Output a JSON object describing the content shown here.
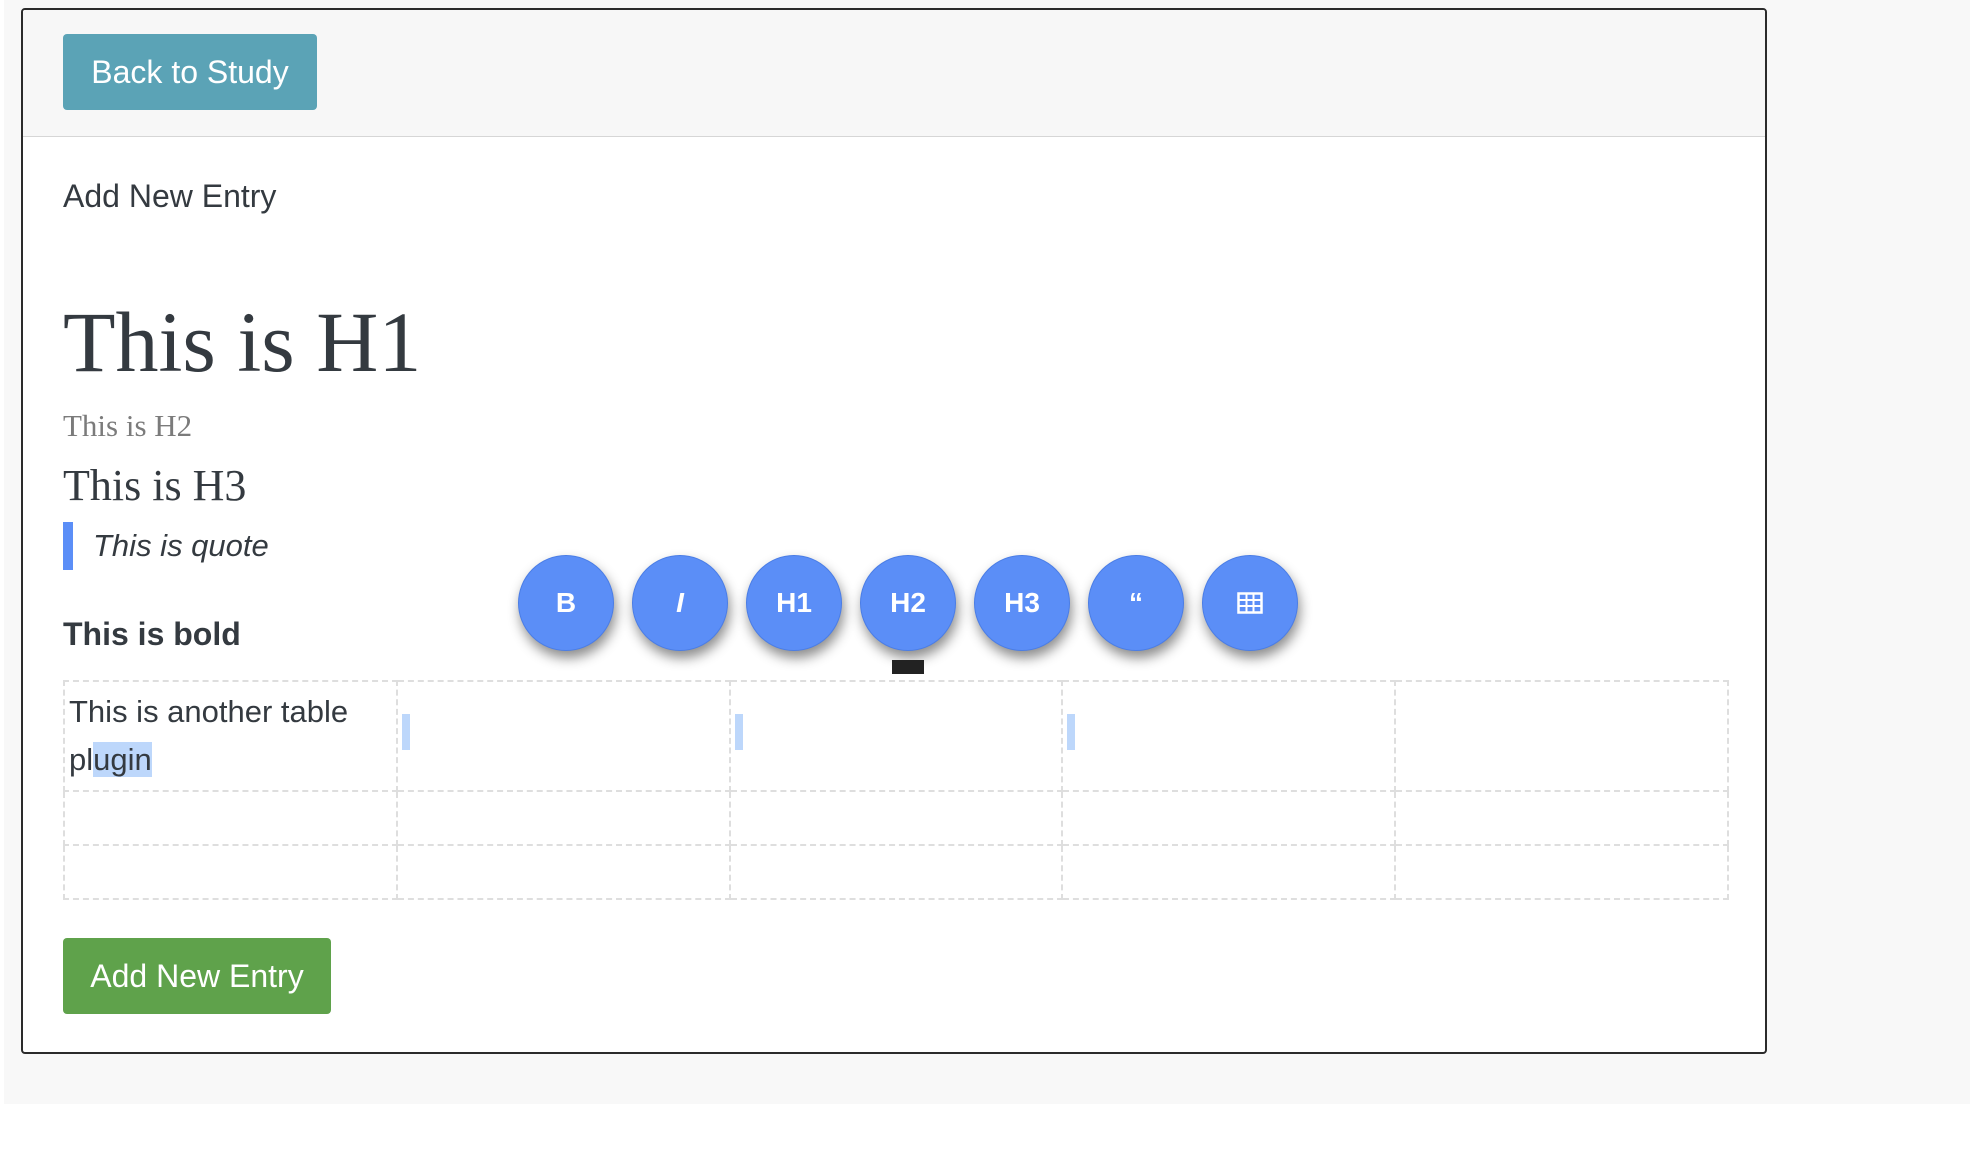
{
  "header": {
    "back_label": "Back to Study"
  },
  "card_title": "Add New Entry",
  "editor": {
    "h1": "This is H1",
    "h2": "This is H2",
    "h3": "This is H3",
    "quote": "This is quote",
    "bold": "This is bold",
    "table": {
      "cell_prefix": "This is another table pl",
      "cell_selected": "ugin "
    }
  },
  "toolbar": {
    "buttons": [
      "B",
      "I",
      "H1",
      "H2",
      "H3",
      "“",
      "table-icon"
    ]
  },
  "submit_label": "Add New Entry",
  "colors": {
    "toolbar": "#5b8ef7",
    "back_button": "#5ba3b6",
    "submit_button": "#5fa24b",
    "quote_border": "#5b8ef7"
  }
}
